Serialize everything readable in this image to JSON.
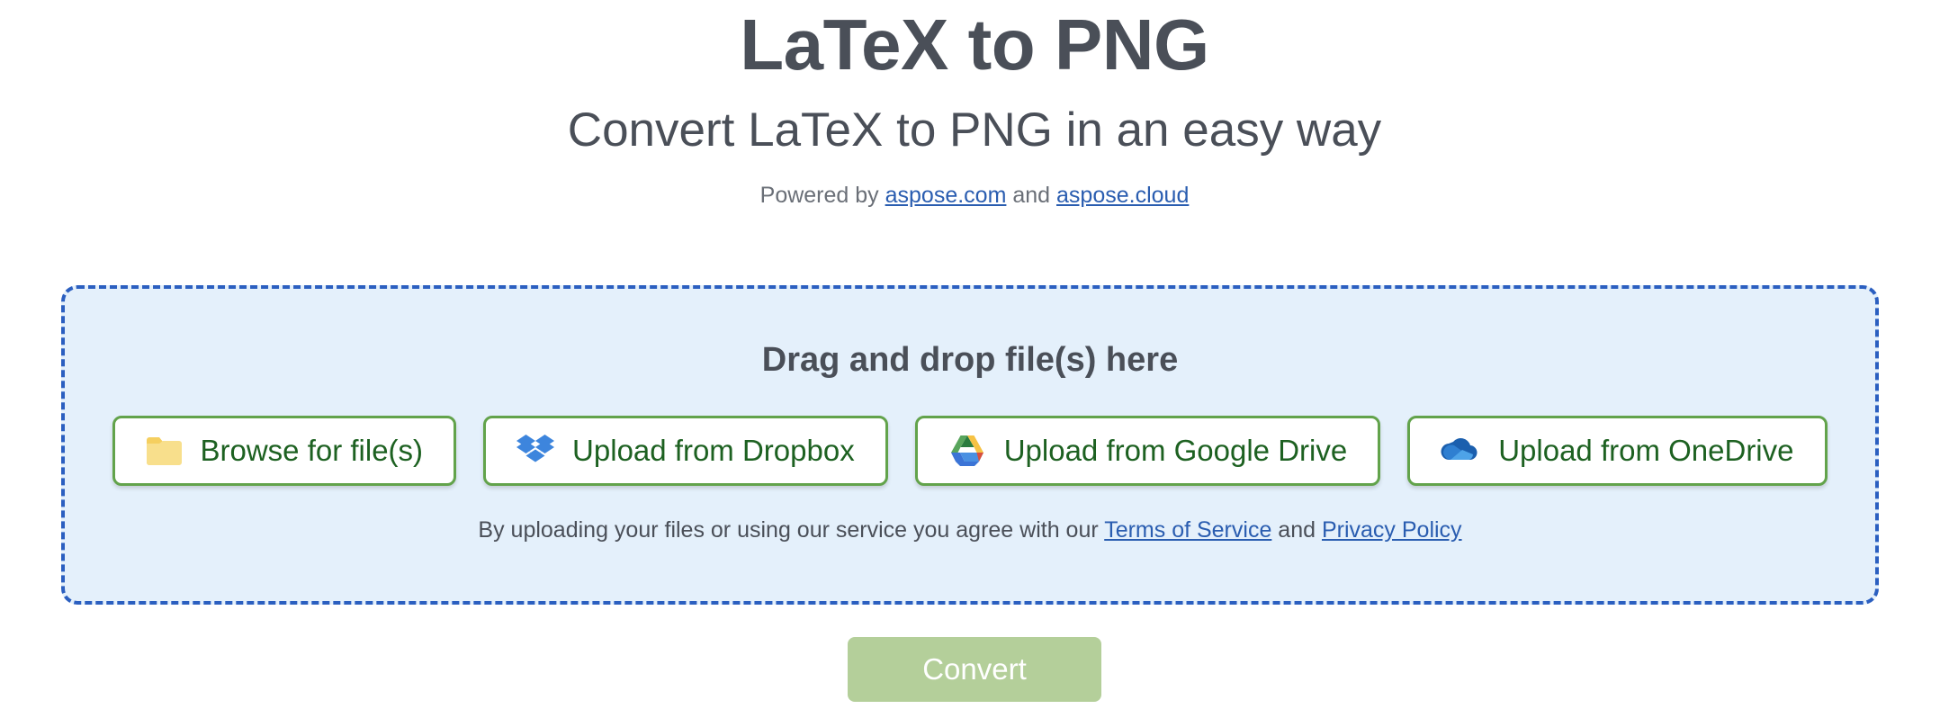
{
  "header": {
    "title": "LaTeX to PNG",
    "subtitle": "Convert LaTeX to PNG in an easy way",
    "powered_by_prefix": "Powered by ",
    "powered_by_link1": "aspose.com",
    "powered_by_conjunction": " and ",
    "powered_by_link2": "aspose.cloud"
  },
  "dropzone": {
    "title": "Drag and drop file(s) here",
    "buttons": [
      {
        "label": "Browse for file(s)",
        "icon": "folder-icon"
      },
      {
        "label": "Upload from Dropbox",
        "icon": "dropbox-icon"
      },
      {
        "label": "Upload from Google Drive",
        "icon": "google-drive-icon"
      },
      {
        "label": "Upload from OneDrive",
        "icon": "onedrive-icon"
      }
    ],
    "terms_prefix": "By uploading your files or using our service you agree with our ",
    "terms_link1": "Terms of Service",
    "terms_conjunction": " and ",
    "terms_link2": "Privacy Policy"
  },
  "actions": {
    "convert_label": "Convert"
  },
  "colors": {
    "title_text": "#4a4f58",
    "link_blue": "#2a5db0",
    "dropzone_background": "#e4f0fb",
    "dropzone_border": "#2b5fc0",
    "button_border_green": "#62a34b",
    "button_text_green": "#1d6121",
    "convert_button_background": "#b4cf9a",
    "convert_button_text": "#ffffff"
  }
}
